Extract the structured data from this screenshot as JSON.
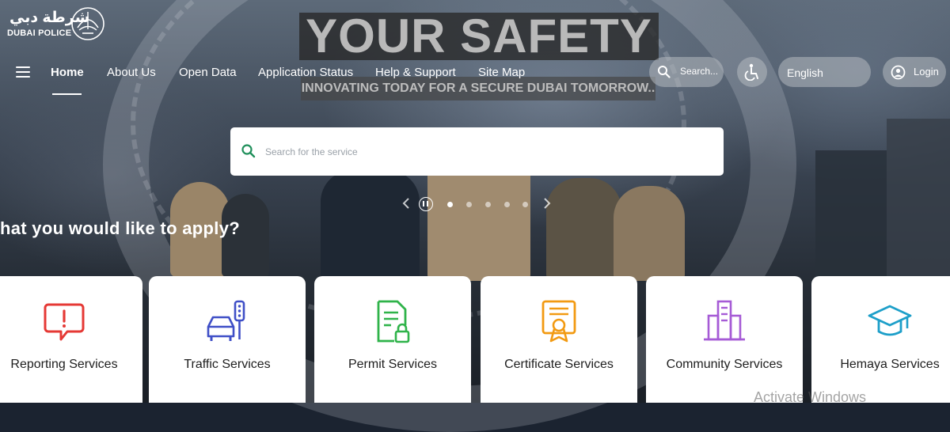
{
  "logo": {
    "arabic": "شرطة دبي",
    "english": "DUBAI POLICE",
    "emblem_icon": "police-emblem"
  },
  "hero": {
    "headline": "YOUR SAFETY",
    "subline": "INNOVATING TODAY FOR A SECURE DUBAI TOMORROW..",
    "apply_text": "hat you would like to apply?"
  },
  "nav": {
    "items": [
      {
        "label": "Home",
        "active": true
      },
      {
        "label": "About Us"
      },
      {
        "label": "Open Data"
      },
      {
        "label": "Application Status"
      },
      {
        "label": "Help & Support"
      },
      {
        "label": "Site Map"
      }
    ],
    "search_label": "Search...",
    "language": "English",
    "login_label": "Login"
  },
  "service_search": {
    "placeholder": "Search for the service"
  },
  "carousel": {
    "slide_count": 5,
    "active_slide": 1
  },
  "services": [
    {
      "label": "Reporting Services",
      "icon": "report-alert-icon",
      "color": "#e53935"
    },
    {
      "label": "Traffic Services",
      "icon": "traffic-car-icon",
      "color": "#3f4fc7"
    },
    {
      "label": "Permit Services",
      "icon": "permit-document-icon",
      "color": "#2fb34a"
    },
    {
      "label": "Certificate Services",
      "icon": "certificate-icon",
      "color": "#f29a12"
    },
    {
      "label": "Community Services",
      "icon": "community-building-icon",
      "color": "#a65bd6"
    },
    {
      "label": "Hemaya Services",
      "icon": "graduation-cap-icon",
      "color": "#1d9fc9"
    }
  ],
  "system": {
    "watermark": "Activate Windows"
  },
  "colors": {
    "nav_text": "#ffffff",
    "card_bg": "#ffffff",
    "search_icon": "#1f8f5a"
  }
}
